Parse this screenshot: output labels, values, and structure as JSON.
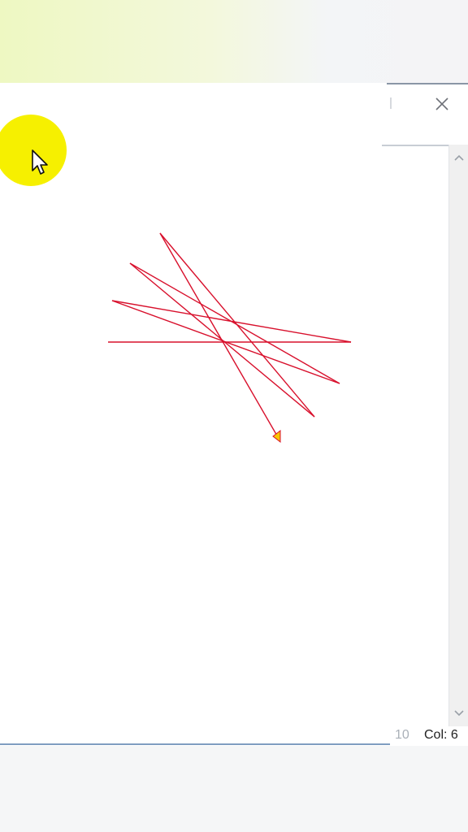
{
  "window": {
    "close_icon": "close-icon"
  },
  "scrollbar": {
    "up_icon": "chevron-up-icon",
    "down_icon": "chevron-down-icon"
  },
  "canvas": {
    "stroke_color": "#d8102c",
    "arrowhead_color": "#f7c600"
  },
  "cursor": {
    "highlight_color": "#f6f000",
    "icon": "mouse-pointer-icon"
  },
  "statusbar": {
    "line_fragment": "10",
    "col_label": "Col: 6"
  }
}
